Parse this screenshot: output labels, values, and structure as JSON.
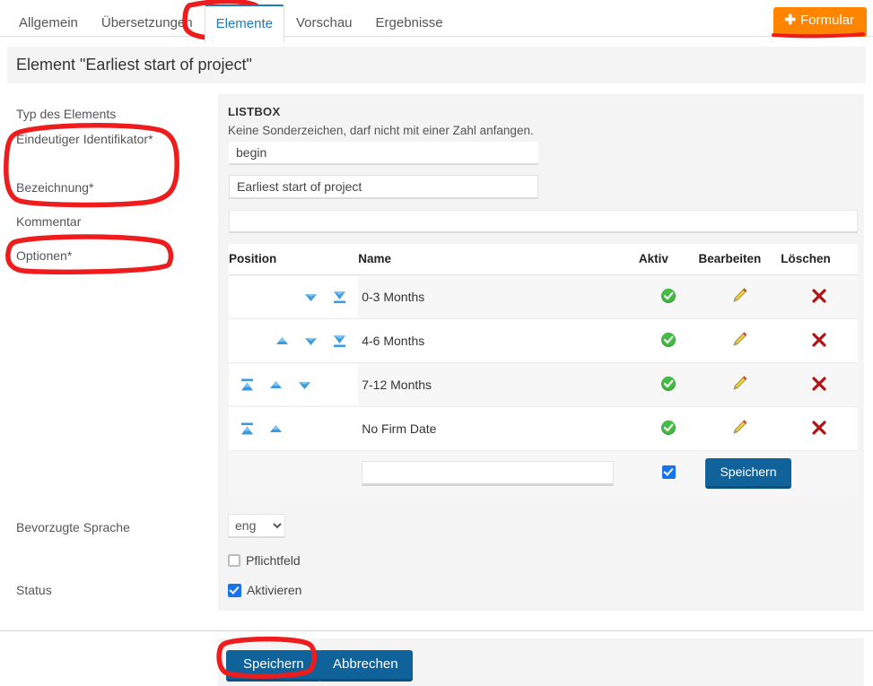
{
  "tabs": [
    {
      "label": "Allgemein",
      "active": false
    },
    {
      "label": "Übersetzungen",
      "active": false
    },
    {
      "label": "Elemente",
      "active": true
    },
    {
      "label": "Vorschau",
      "active": false
    },
    {
      "label": "Ergebnisse",
      "active": false
    }
  ],
  "header": {
    "new_form_button": "Formular",
    "new_form_plus": "✚",
    "page_title": "Element \"Earliest start of project\""
  },
  "labels": {
    "type": "Typ des Elements",
    "identifier": "Eindeutiger Identifikator*",
    "designation": "Bezeichnung*",
    "comment": "Kommentar",
    "options": "Optionen*",
    "preferred_language": "Bevorzugte Sprache",
    "status": "Status"
  },
  "panel": {
    "element_type": "LISTBOX",
    "hint": "Keine Sonderzeichen, darf nicht mit einer Zahl anfangen.",
    "identifier_value": "begin",
    "identifier_placeholder": "",
    "designation_value": "Earliest start of project",
    "designation_placeholder": "",
    "comment_value": "",
    "comment_placeholder": ""
  },
  "options_table": {
    "columns": [
      "Position",
      "Name",
      "Aktiv",
      "Bearbeiten",
      "Löschen"
    ],
    "rows": [
      {
        "name": "0-3 Months",
        "active": true,
        "move_top": false,
        "move_up": false,
        "move_down": true,
        "move_bottom": true
      },
      {
        "name": "4-6 Months",
        "active": true,
        "move_top": false,
        "move_up": true,
        "move_down": true,
        "move_bottom": true
      },
      {
        "name": "7-12 Months",
        "active": true,
        "move_top": true,
        "move_up": true,
        "move_down": true,
        "move_bottom": false
      },
      {
        "name": "No Firm Date",
        "active": true,
        "move_top": true,
        "move_up": true,
        "move_down": false,
        "move_bottom": false
      }
    ],
    "add_row": {
      "input_value": "",
      "input_placeholder": "",
      "active_checked": true,
      "save_label": "Speichern"
    }
  },
  "settings": {
    "language_selected": "eng",
    "language_options": [
      "eng"
    ],
    "required_label": "Pflichtfeld",
    "required_checked": false,
    "activate_label": "Aktivieren",
    "activate_checked": true
  },
  "footer": {
    "save_label": "Speichern",
    "cancel_label": "Abbrechen"
  },
  "colors": {
    "accent_blue": "#1b7bbd",
    "button_blue": "#10639a",
    "orange": "#ff8400",
    "annotation_red": "#ee1c1c",
    "active_green": "#3aa43a",
    "delete_red": "#b11414",
    "panel_grey": "#f4f4f4"
  }
}
